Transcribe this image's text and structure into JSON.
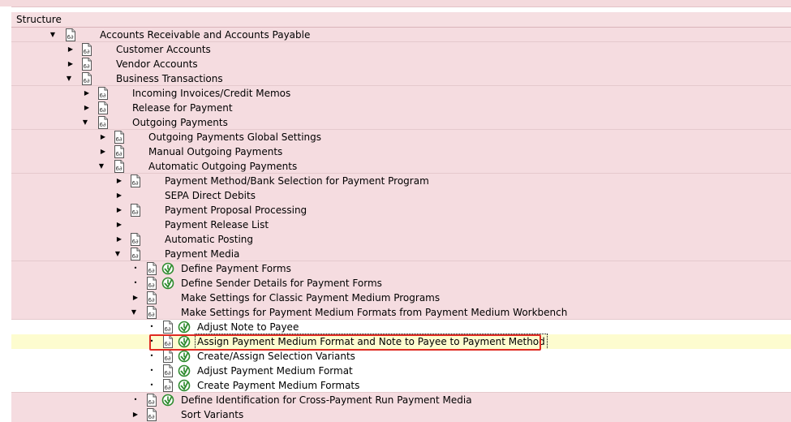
{
  "header": {
    "title": "Structure"
  },
  "tree": {
    "r1": {
      "label": "Accounts Receivable and Accounts Payable"
    },
    "r2": {
      "label": "Customer Accounts"
    },
    "r3": {
      "label": "Vendor Accounts"
    },
    "r4": {
      "label": "Business Transactions"
    },
    "r5": {
      "label": "Incoming Invoices/Credit Memos"
    },
    "r6": {
      "label": "Release for Payment"
    },
    "r7": {
      "label": "Outgoing Payments"
    },
    "r8": {
      "label": "Outgoing Payments Global Settings"
    },
    "r9": {
      "label": "Manual Outgoing Payments"
    },
    "r10": {
      "label": "Automatic Outgoing Payments"
    },
    "r11": {
      "label": "Payment Method/Bank Selection for Payment Program"
    },
    "r12": {
      "label": "SEPA Direct Debits"
    },
    "r13": {
      "label": "Payment Proposal Processing"
    },
    "r14": {
      "label": "Payment Release List"
    },
    "r15": {
      "label": "Automatic Posting"
    },
    "r16": {
      "label": "Payment Media"
    },
    "r17": {
      "label": "Define Payment Forms"
    },
    "r18": {
      "label": "Define Sender Details for Payment Forms"
    },
    "r19": {
      "label": "Make Settings for Classic Payment Medium Programs"
    },
    "r20": {
      "label": "Make Settings for Payment Medium Formats from Payment Medium Workbench"
    },
    "r21": {
      "label": "Adjust Note to Payee"
    },
    "r22": {
      "label": "Assign Payment Medium Format and Note to Payee to Payment Method"
    },
    "r23": {
      "label": "Create/Assign Selection Variants"
    },
    "r24": {
      "label": "Adjust Payment Medium Format"
    },
    "r25": {
      "label": "Create Payment Medium Formats"
    },
    "r26": {
      "label": "Define Identification for Cross-Payment Run Payment Media"
    },
    "r27": {
      "label": "Sort Variants"
    }
  },
  "icons": {
    "expanded": "▼",
    "collapsed": "▶",
    "leaf": "•",
    "document": "img-document-icon",
    "execute": "img-activity-clock-icon"
  },
  "colors": {
    "row_pink": "#f5dce0",
    "selected_row": "#fdfccf",
    "highlight_box": "#e02a22",
    "clock_green": "#2e8b2e"
  }
}
